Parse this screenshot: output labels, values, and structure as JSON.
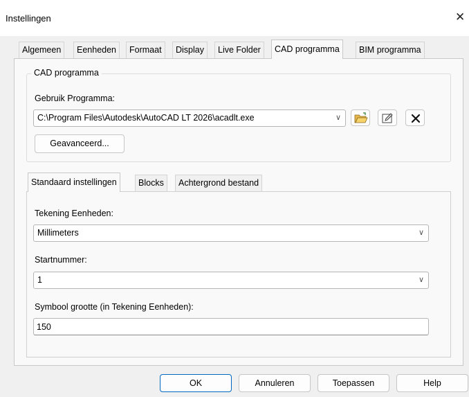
{
  "window": {
    "title": "Instellingen",
    "close_glyph": "✕"
  },
  "tabs": [
    {
      "label": "Algemeen"
    },
    {
      "label": "Eenheden"
    },
    {
      "label": "Formaat"
    },
    {
      "label": "Display"
    },
    {
      "label": "Live Folder"
    },
    {
      "label": "CAD programma",
      "active": true
    },
    {
      "label": "BIM programma"
    }
  ],
  "cad_group": {
    "legend": "CAD programma",
    "program_label": "Gebruik Programma:",
    "program_path": "C:\\Program Files\\Autodesk\\AutoCAD LT 2026\\acadlt.exe",
    "advanced_button": "Geavanceerd...",
    "icons": [
      "folder-open-icon",
      "edit-icon",
      "delete-icon"
    ]
  },
  "subtabs": [
    {
      "label": "Standaard instellingen",
      "active": true
    },
    {
      "label": "Blocks"
    },
    {
      "label": "Achtergrond bestand"
    }
  ],
  "settings": {
    "units_label": "Tekening Eenheden:",
    "units_value": "Millimeters",
    "start_label": "Startnummer:",
    "start_value": "1",
    "symbol_label": "Symbool grootte (in Tekening Eenheden):",
    "symbol_value": "150"
  },
  "footer": {
    "ok": "OK",
    "cancel": "Annuleren",
    "apply": "Toepassen",
    "help": "Help"
  },
  "colors": {
    "accent": "#0067c0",
    "window_bg": "#f0f0f0",
    "panel_bg": "#f9f9f9"
  }
}
